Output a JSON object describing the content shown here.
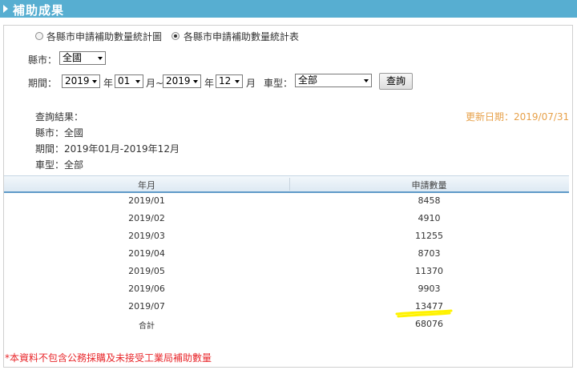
{
  "header": {
    "title": "補助成果"
  },
  "view_options": [
    {
      "label": "各縣市申請補助數量統計圖",
      "selected": false
    },
    {
      "label": "各縣市申請補助數量統計表",
      "selected": true
    }
  ],
  "filters": {
    "county_label": "縣市：",
    "county_value": "全國",
    "period_label": "期間：",
    "start_year": "2019",
    "year_unit": "年",
    "start_month": "01",
    "month_tilde": "月~",
    "end_year": "2019",
    "end_month": "12",
    "month_unit": "月",
    "vehicle_label": "車型：",
    "vehicle_value": "全部",
    "query_button": "查詢"
  },
  "result": {
    "heading": "查詢結果：",
    "county_line": "縣市：全國",
    "period_line": "期間：2019年01月-2019年12月",
    "vehicle_line": "車型：全部",
    "updated": "更新日期：2019/07/31"
  },
  "table": {
    "columns": [
      "年月",
      "申請數量"
    ],
    "rows": [
      [
        "2019/01",
        "8458"
      ],
      [
        "2019/02",
        "4910"
      ],
      [
        "2019/03",
        "11255"
      ],
      [
        "2019/04",
        "8703"
      ],
      [
        "2019/05",
        "11370"
      ],
      [
        "2019/06",
        "9903"
      ],
      [
        "2019/07",
        "13477"
      ],
      [
        "合計",
        "68076"
      ]
    ]
  },
  "footnote": "*本資料不包含公務採購及未接受工業局補助數量",
  "colors": {
    "header_bar": "#57aed1",
    "update_text": "#e7a14a",
    "footnote": "#e8262a",
    "highlight": "#fff200"
  }
}
